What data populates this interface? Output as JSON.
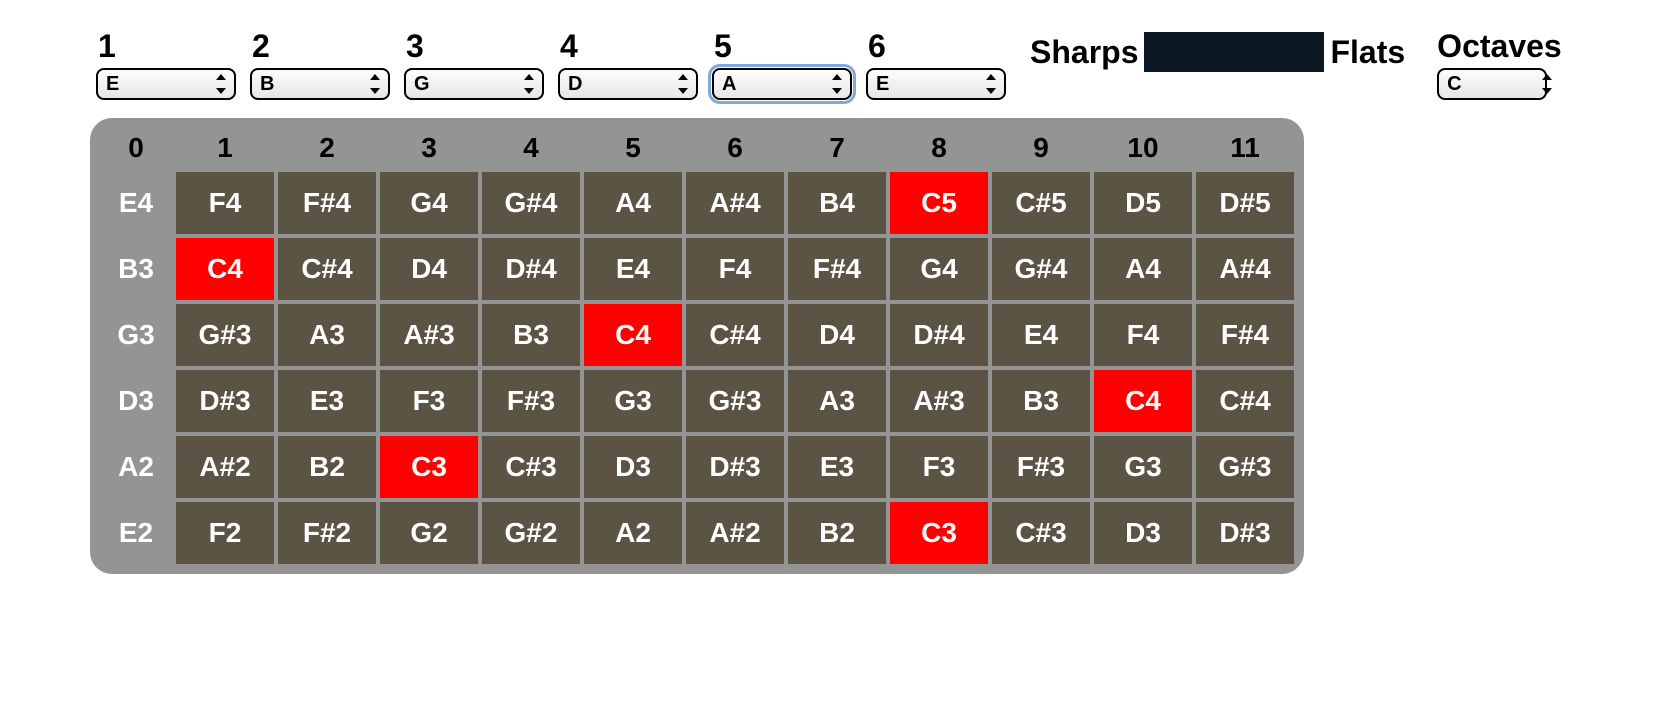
{
  "strings": [
    {
      "num": "1",
      "tuning": "E"
    },
    {
      "num": "2",
      "tuning": "B"
    },
    {
      "num": "3",
      "tuning": "G"
    },
    {
      "num": "4",
      "tuning": "D"
    },
    {
      "num": "5",
      "tuning": "A"
    },
    {
      "num": "6",
      "tuning": "E"
    }
  ],
  "focused_string_index": 4,
  "toggle": {
    "sharps": "Sharps",
    "flats": "Flats"
  },
  "octave": {
    "label": "Octaves",
    "value": "C"
  },
  "fret_numbers": [
    "0",
    "1",
    "2",
    "3",
    "4",
    "5",
    "6",
    "7",
    "8",
    "9",
    "10",
    "11"
  ],
  "fretboard": [
    {
      "open": "E4",
      "frets": [
        "F4",
        "F#4",
        "G4",
        "G#4",
        "A4",
        "A#4",
        "B4",
        "C5",
        "C#5",
        "D5",
        "D#5"
      ],
      "highlight_at": 7
    },
    {
      "open": "B3",
      "frets": [
        "C4",
        "C#4",
        "D4",
        "D#4",
        "E4",
        "F4",
        "F#4",
        "G4",
        "G#4",
        "A4",
        "A#4"
      ],
      "highlight_at": 0
    },
    {
      "open": "G3",
      "frets": [
        "G#3",
        "A3",
        "A#3",
        "B3",
        "C4",
        "C#4",
        "D4",
        "D#4",
        "E4",
        "F4",
        "F#4"
      ],
      "highlight_at": 4
    },
    {
      "open": "D3",
      "frets": [
        "D#3",
        "E3",
        "F3",
        "F#3",
        "G3",
        "G#3",
        "A3",
        "A#3",
        "B3",
        "C4",
        "C#4"
      ],
      "highlight_at": 9
    },
    {
      "open": "A2",
      "frets": [
        "A#2",
        "B2",
        "C3",
        "C#3",
        "D3",
        "D#3",
        "E3",
        "F3",
        "F#3",
        "G3",
        "G#3"
      ],
      "highlight_at": 2
    },
    {
      "open": "E2",
      "frets": [
        "F2",
        "F#2",
        "G2",
        "G#2",
        "A2",
        "A#2",
        "B2",
        "C3",
        "C#3",
        "D3",
        "D#3"
      ],
      "highlight_at": 7
    }
  ]
}
